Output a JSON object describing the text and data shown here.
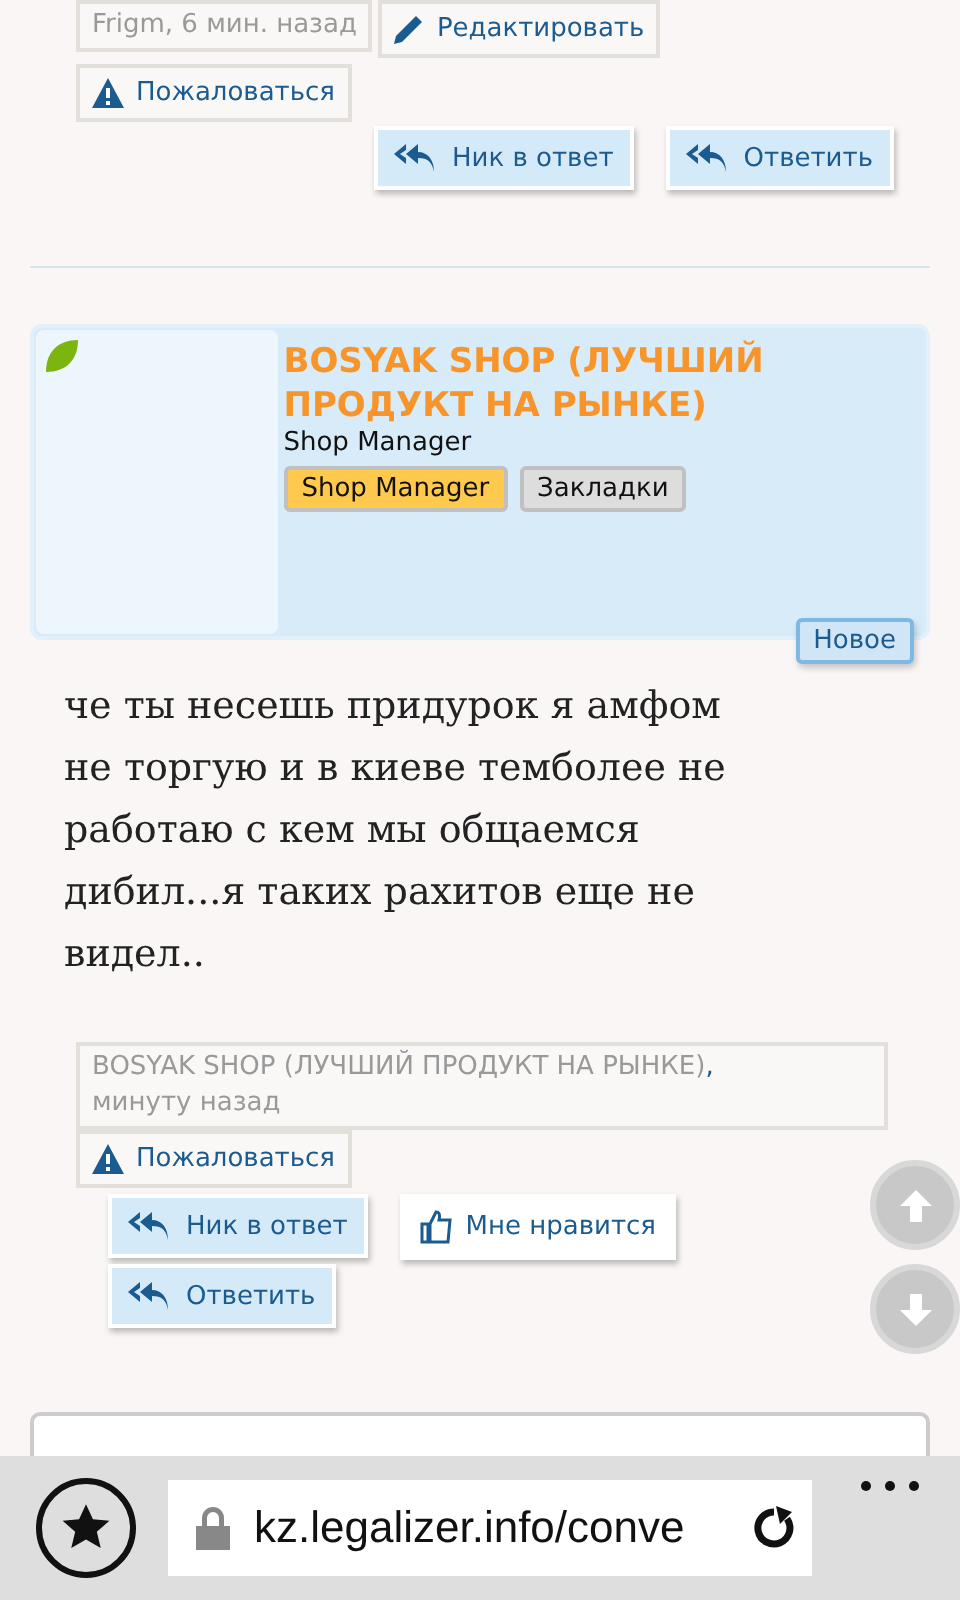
{
  "previous_post": {
    "meta": {
      "author": "Frigm",
      "time": ", 6 мин. назад"
    },
    "edit": "Редактировать",
    "report": "Пожаловаться",
    "actions": [
      {
        "kind": "reply",
        "label": "Ник в ответ"
      },
      {
        "kind": "reply",
        "label": "Ответить"
      }
    ]
  },
  "post": {
    "user": {
      "name": "BOSYAK SHOP (ЛУЧШИЙ ПРОДУКТ НА РЫНКЕ)",
      "title": "Shop Manager",
      "badges": [
        {
          "label": "Shop Manager",
          "color": "#ffc94d"
        },
        {
          "label": "Закладки",
          "color": "#dddddd"
        }
      ],
      "online": true
    },
    "new_label": "Новое",
    "text": "че ты несешь придурок я амфом не торгую и в киеве темболее не работаю с кем мы общаемся дибил...я таких рахитов еще не видел..",
    "meta": {
      "author": "BOSYAK SHOP (ЛУЧШИЙ ПРОДУКТ НА РЫНКЕ)",
      "separator": ",",
      "time": "минуту назад"
    },
    "report": "Пожаловаться",
    "actions": [
      {
        "kind": "reply",
        "label": "Ник в ответ"
      },
      {
        "kind": "like",
        "label": "Мне нравится"
      },
      {
        "kind": "reply",
        "label": "Ответить"
      }
    ]
  },
  "browser": {
    "url": "kz.legalizer.info/conve"
  }
}
